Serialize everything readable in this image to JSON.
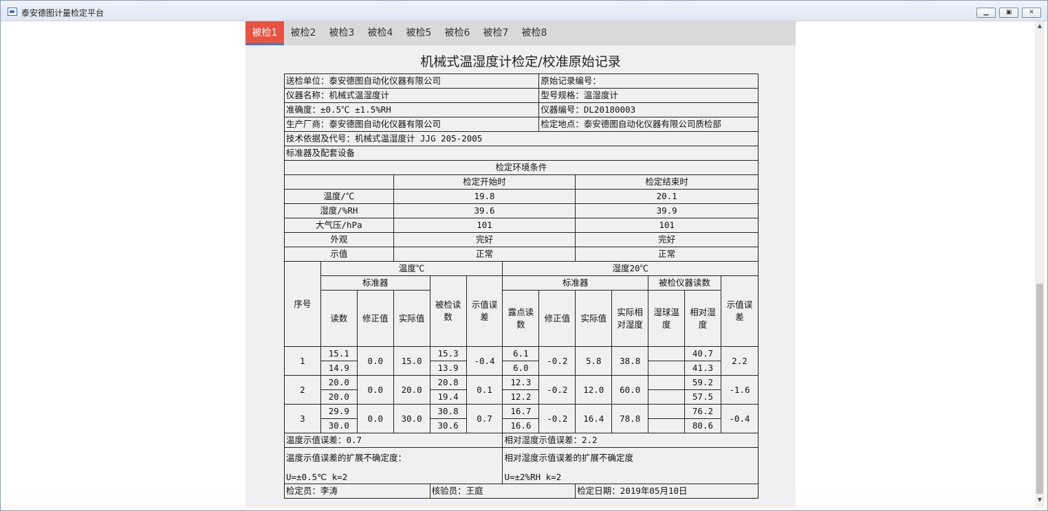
{
  "window": {
    "title": "泰安德图计量检定平台"
  },
  "tabs": [
    "被检1",
    "被检2",
    "被检3",
    "被检4",
    "被检5",
    "被检6",
    "被检7",
    "被检8"
  ],
  "doc": {
    "title": "机械式温湿度计检定/校准原始记录",
    "info": {
      "client": "送检单位：泰安德图自动化仪器有限公司",
      "record_no": "原始记录编号：",
      "instrument": "仪器名称：机械式温湿度计",
      "model": "型号规格：温湿度计",
      "accuracy": "准确度：±0.5℃ ±1.5%RH",
      "serial": "仪器编号：DL20180003",
      "maker": "生产厂商：泰安德图自动化仪器有限公司",
      "location": "检定地点：泰安德图自动化仪器有限公司质检部",
      "basis": "技术依据及代号：机械式温湿度计 JJG 205-2005",
      "standards": "标准器及配套设备"
    },
    "env": {
      "title": "检定环境条件",
      "col_start": "检定开始时",
      "col_end": "检定结束时",
      "rows": [
        {
          "label": "温度/℃",
          "start": "19.8",
          "end": "20.1"
        },
        {
          "label": "湿度/%RH",
          "start": "39.6",
          "end": "39.9"
        },
        {
          "label": "大气压/hPa",
          "start": "101",
          "end": "101"
        },
        {
          "label": "外观",
          "start": "完好",
          "end": "完好"
        },
        {
          "label": "示值",
          "start": "正常",
          "end": "正常"
        }
      ]
    },
    "headers": {
      "seq": "序号",
      "temp_group": "温度℃",
      "hum_group": "湿度20℃",
      "std": "标准器",
      "reading": "读数",
      "correction": "修正值",
      "actual": "实际值",
      "dut_reading": "被检读数",
      "error": "示值误差",
      "dew": "露点读数",
      "correction2": "修正值",
      "actual2": "实际值",
      "actual_rh": "实际相对湿度",
      "dut_group": "被检仪器读数",
      "wet_bulb": "湿球温度",
      "rh": "相对湿度",
      "error2": "示值误差"
    },
    "rows": [
      {
        "seq": "1",
        "read": [
          "15.1",
          "14.9"
        ],
        "corr": "0.0",
        "actual": "15.0",
        "dut": [
          "15.3",
          "13.9"
        ],
        "err": "-0.4",
        "dew": [
          "6.1",
          "6.0"
        ],
        "corr2": "-0.2",
        "actual2": "5.8",
        "arh": "38.8",
        "wet": [
          "",
          ""
        ],
        "rh": [
          "40.7",
          "41.3"
        ],
        "err2": "2.2"
      },
      {
        "seq": "2",
        "read": [
          "20.0",
          "20.0"
        ],
        "corr": "0.0",
        "actual": "20.0",
        "dut": [
          "20.8",
          "19.4"
        ],
        "err": "0.1",
        "dew": [
          "12.3",
          "12.2"
        ],
        "corr2": "-0.2",
        "actual2": "12.0",
        "arh": "60.0",
        "wet": [
          "",
          ""
        ],
        "rh": [
          "59.2",
          "57.5"
        ],
        "err2": "-1.6"
      },
      {
        "seq": "3",
        "read": [
          "29.9",
          "30.0"
        ],
        "corr": "0.0",
        "actual": "30.0",
        "dut": [
          "30.8",
          "30.6"
        ],
        "err": "0.7",
        "dew": [
          "16.7",
          "16.6"
        ],
        "corr2": "-0.2",
        "actual2": "16.4",
        "arh": "78.8",
        "wet": [
          "",
          ""
        ],
        "rh": [
          "76.2",
          "80.6"
        ],
        "err2": "-0.4"
      }
    ],
    "summary": {
      "temp_err": "温度示值误差：0.7",
      "rh_err": "相对湿度示值误差：2.2",
      "temp_unc_label": "温度示值误差的扩展不确定度：",
      "temp_unc": "U=±0.5℃ k=2",
      "rh_unc_label": "相对湿度示值误差的扩展不确定度",
      "rh_unc": "U=±2%RH k=2"
    },
    "footer": {
      "inspector": "检定员：李涛",
      "verifier": "核验员：王庭",
      "date": "检定日期：2019年05月10日"
    }
  }
}
